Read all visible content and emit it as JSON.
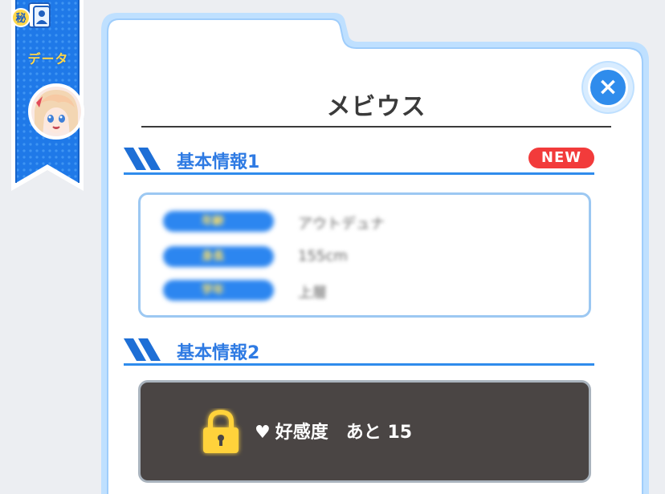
{
  "sidebar": {
    "data_label": "データ",
    "data_icon": "secret-data-icon",
    "avatar_icon": "character-avatar"
  },
  "modal": {
    "title": "メビウス",
    "close_icon": "close-icon",
    "close_label": "×"
  },
  "sections": [
    {
      "label": "基本情報1",
      "badge": "NEW",
      "rows": [
        {
          "key": "年齢",
          "value": "アウトデュナ"
        },
        {
          "key": "身長",
          "value": "155cm"
        },
        {
          "key": "学年",
          "value": "上層"
        }
      ]
    },
    {
      "label": "基本情報2",
      "locked": {
        "icon": "padlock-icon",
        "heart": "♥",
        "requirement": "好感度",
        "remaining_prefix": "あと",
        "remaining": "15"
      }
    }
  ],
  "colors": {
    "accent": "#2f8cec",
    "badge": "#f23b3b",
    "locked_bg": "#4a4544",
    "ribbon": "#1e7ae6"
  }
}
